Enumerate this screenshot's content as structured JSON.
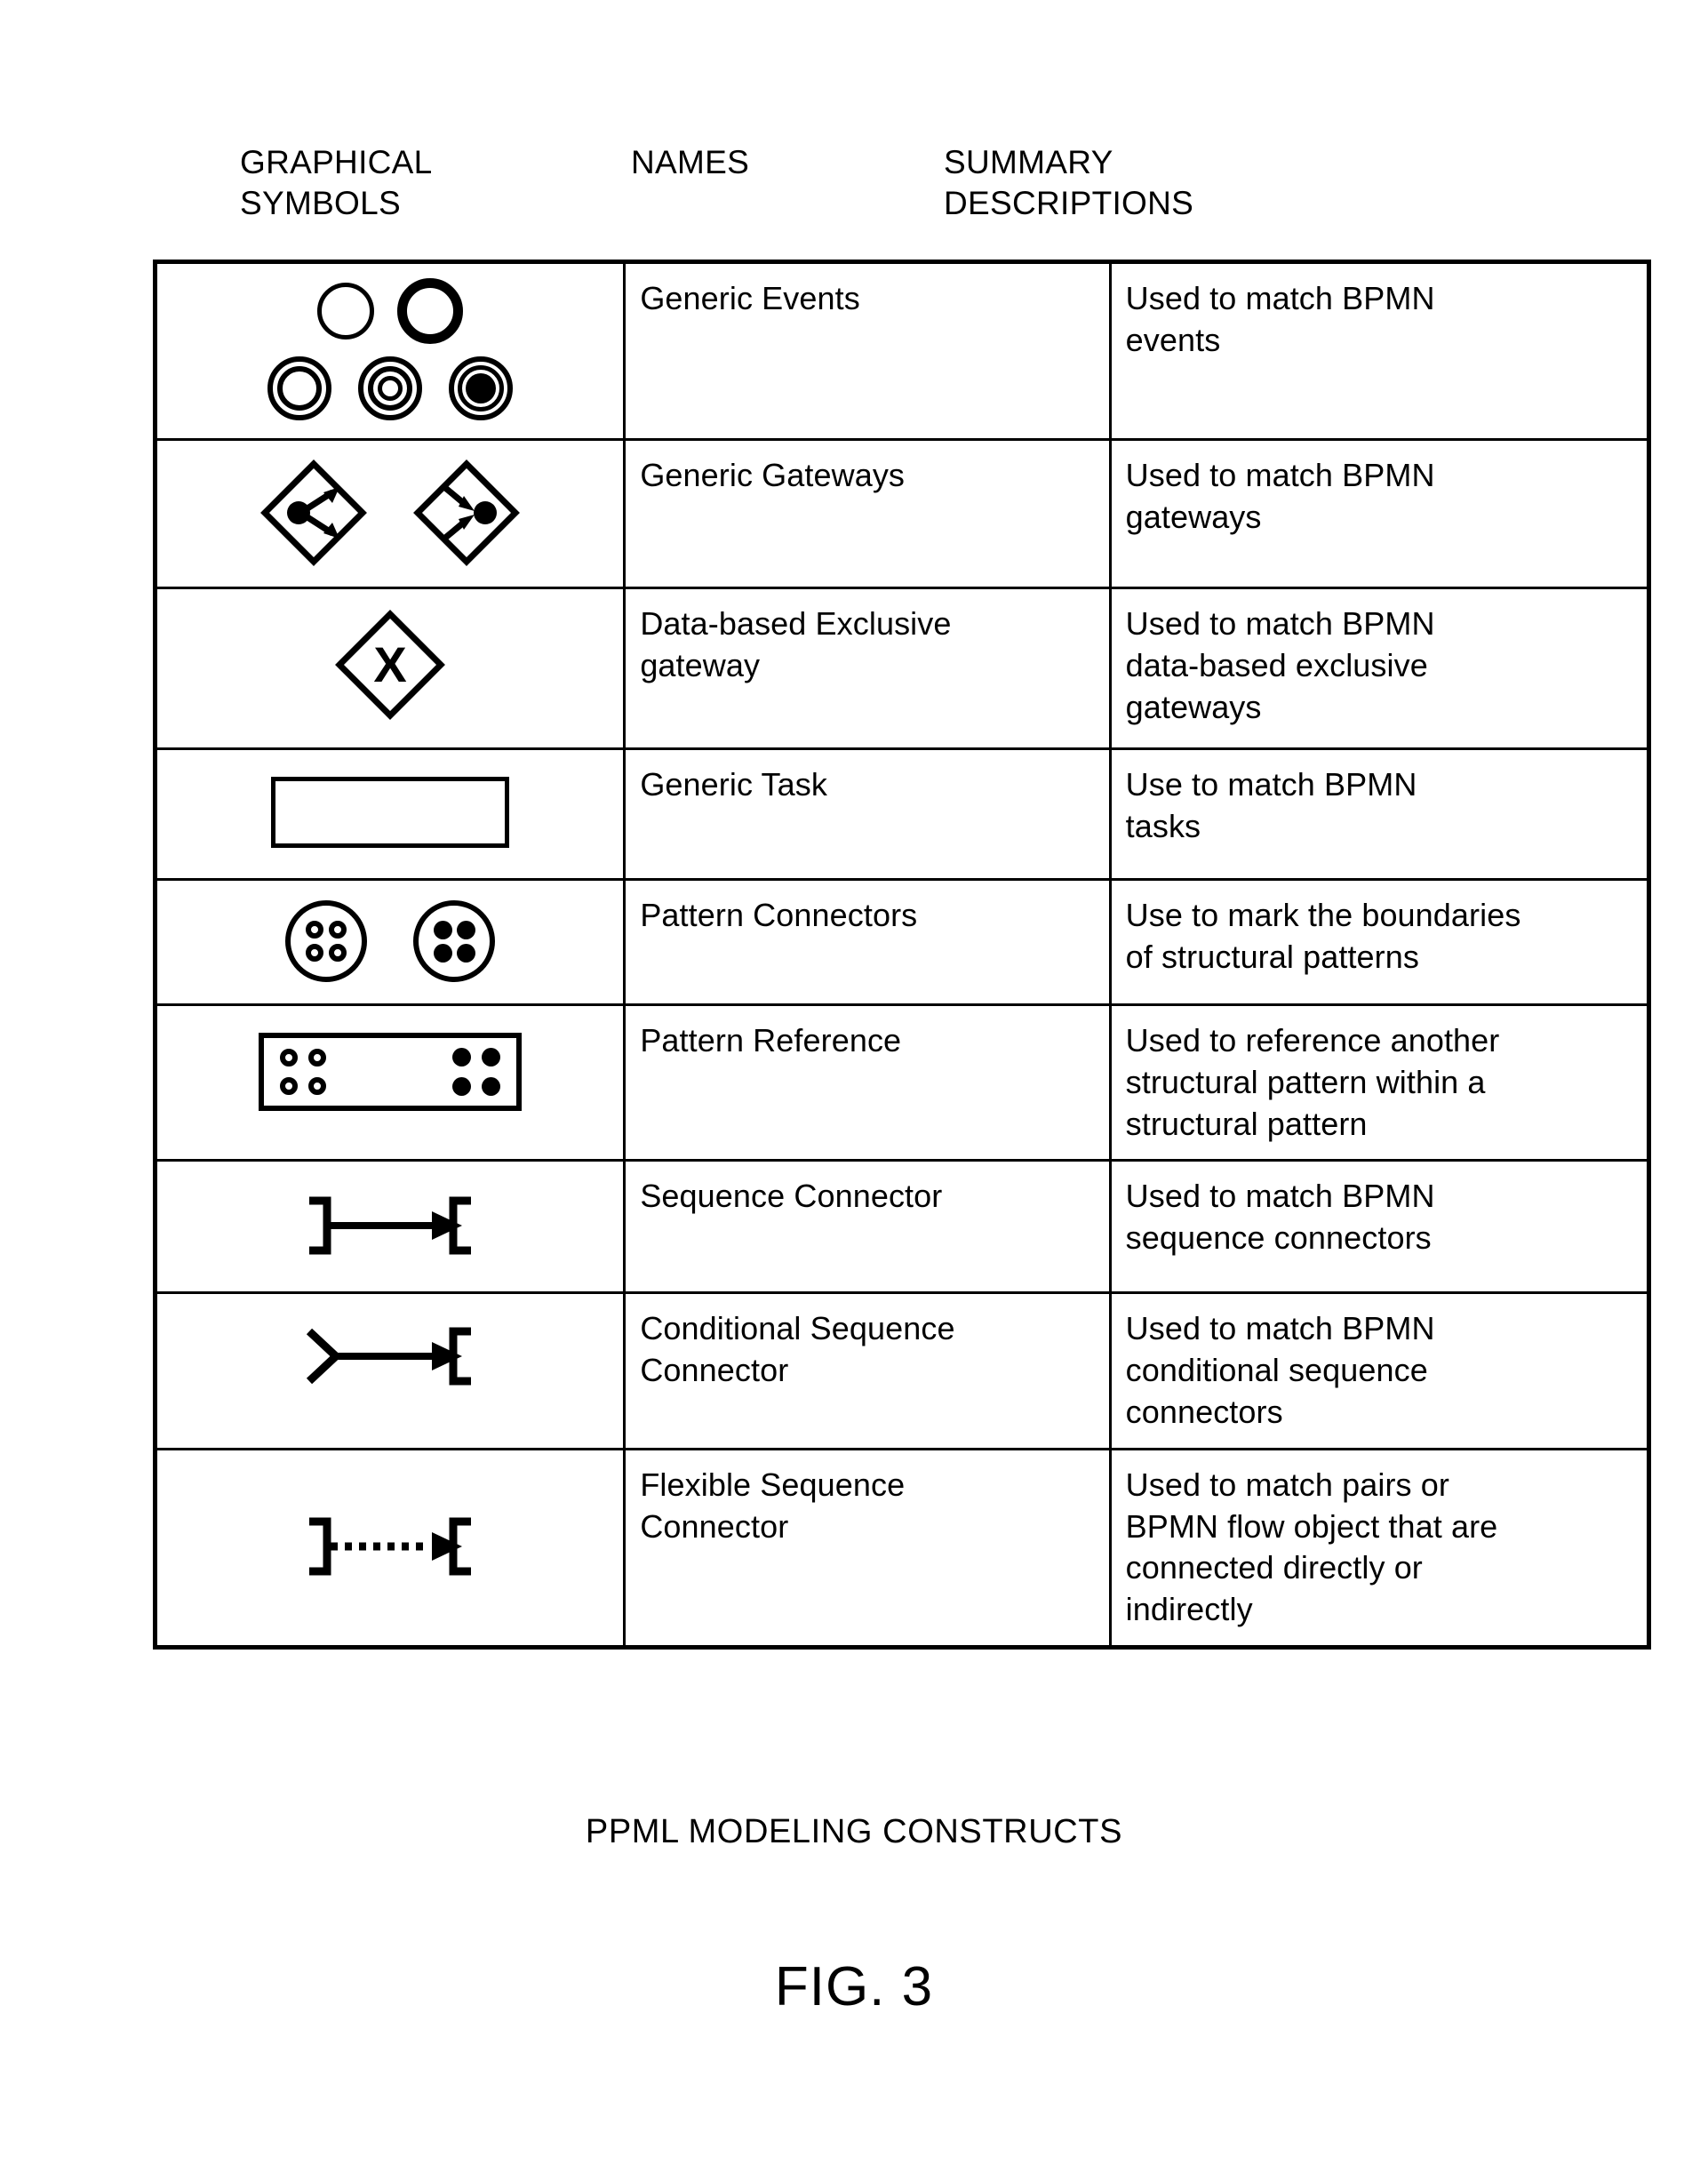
{
  "table": {
    "headers": {
      "symbols": "GRAPHICAL\nSYMBOLS",
      "names": "NAMES",
      "descriptions": "SUMMARY\nDESCRIPTIONS"
    },
    "rows": [
      {
        "symbol_name": "generic-events-symbols",
        "name": "Generic Events",
        "description": "Used to match BPMN\nevents"
      },
      {
        "symbol_name": "generic-gateways-symbols",
        "name": "Generic Gateways",
        "description": "Used to match BPMN\ngateways"
      },
      {
        "symbol_name": "data-based-exclusive-gateway-symbol",
        "name": "Data-based Exclusive\ngateway",
        "description": "Used to match BPMN\ndata-based exclusive\ngateways"
      },
      {
        "symbol_name": "generic-task-symbol",
        "name": "Generic Task",
        "description": "Use to match BPMN\ntasks"
      },
      {
        "symbol_name": "pattern-connectors-symbols",
        "name": "Pattern Connectors",
        "description": "Use to mark the boundaries\nof structural patterns"
      },
      {
        "symbol_name": "pattern-reference-symbol",
        "name": "Pattern Reference",
        "description": "Used to reference another\nstructural pattern within a\nstructural pattern"
      },
      {
        "symbol_name": "sequence-connector-symbol",
        "name": "Sequence Connector",
        "description": "Used to match BPMN\nsequence connectors"
      },
      {
        "symbol_name": "conditional-sequence-connector-symbol",
        "name": "Conditional Sequence\nConnector",
        "description": "Used to match BPMN\nconditional sequence\nconnectors"
      },
      {
        "symbol_name": "flexible-sequence-connector-symbol",
        "name": "Flexible Sequence\nConnector",
        "description": "Used to match pairs or\nBPMN flow object that are\nconnected directly or\nindirectly"
      }
    ]
  },
  "caption": "PPML MODELING CONSTRUCTS",
  "figure_label": "FIG. 3",
  "colors": {
    "ink": "#000000",
    "paper": "#ffffff"
  },
  "glyphs": {
    "exclusive_gateway_mark": "X"
  }
}
